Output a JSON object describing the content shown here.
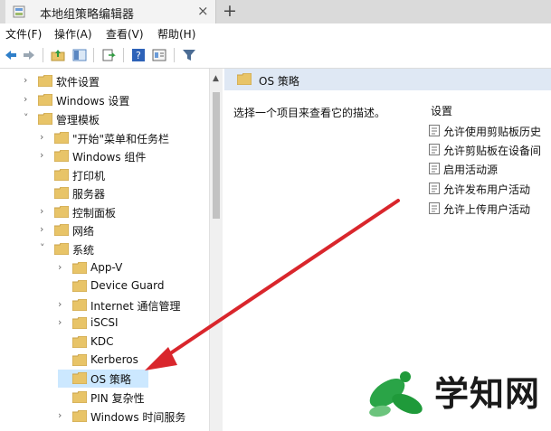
{
  "window": {
    "tab_title": "本地组策略编辑器",
    "close": "×",
    "new_tab": "+"
  },
  "menu": [
    "文件(F)",
    "操作(A)",
    "查看(V)",
    "帮助(H)"
  ],
  "tree": [
    {
      "label": "软件设置",
      "arrow": "›",
      "level": 1
    },
    {
      "label": "Windows 设置",
      "arrow": "›",
      "level": 1
    },
    {
      "label": "管理模板",
      "arrow": "˅",
      "level": 1
    },
    {
      "label": "\"开始\"菜单和任务栏",
      "arrow": "›",
      "level": 2
    },
    {
      "label": "Windows 组件",
      "arrow": "›",
      "level": 2
    },
    {
      "label": "打印机",
      "arrow": "",
      "level": 2
    },
    {
      "label": "服务器",
      "arrow": "",
      "level": 2
    },
    {
      "label": "控制面板",
      "arrow": "›",
      "level": 2
    },
    {
      "label": "网络",
      "arrow": "›",
      "level": 2
    },
    {
      "label": "系统",
      "arrow": "˅",
      "level": 2
    },
    {
      "label": "App-V",
      "arrow": "›",
      "level": 3
    },
    {
      "label": "Device Guard",
      "arrow": "",
      "level": 3
    },
    {
      "label": "Internet 通信管理",
      "arrow": "›",
      "level": 3
    },
    {
      "label": "iSCSI",
      "arrow": "›",
      "level": 3
    },
    {
      "label": "KDC",
      "arrow": "",
      "level": 3
    },
    {
      "label": "Kerberos",
      "arrow": "",
      "level": 3
    },
    {
      "label": "OS 策略",
      "arrow": "",
      "level": 3,
      "selected": true
    },
    {
      "label": "PIN 复杂性",
      "arrow": "",
      "level": 3
    },
    {
      "label": "Windows 时间服务",
      "arrow": "›",
      "level": 3
    }
  ],
  "right": {
    "header": "OS 策略",
    "description": "选择一个项目来查看它的描述。",
    "column": "设置",
    "settings": [
      "允许使用剪贴板历史",
      "允许剪贴板在设备间",
      "启用活动源",
      "允许发布用户活动",
      "允许上传用户活动"
    ]
  },
  "watermark": {
    "text": "学知网"
  },
  "colors": {
    "accent_arrow": "#d9262c",
    "folder": "#e8c468",
    "header_bg": "#dfe8f4",
    "selection": "#cce8ff",
    "watermark_green": "#1f9a3a"
  }
}
